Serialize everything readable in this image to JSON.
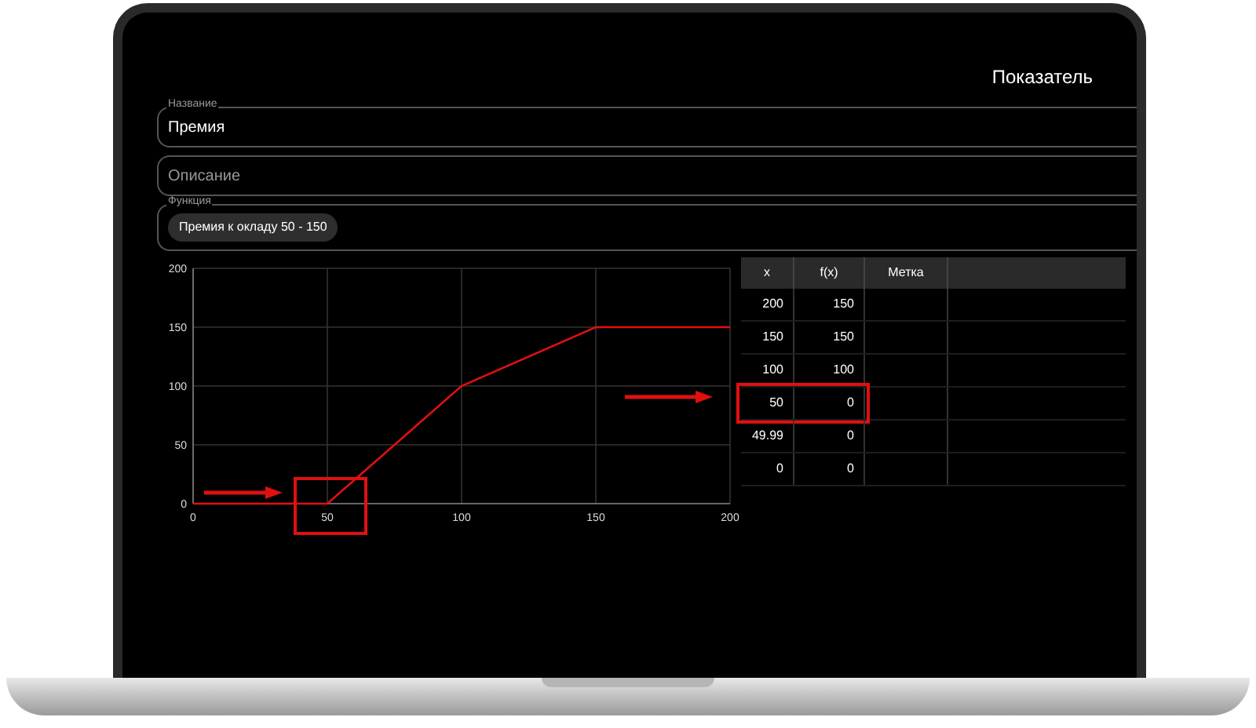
{
  "header": {
    "title": "Показатель"
  },
  "fields": [
    {
      "kind": "text",
      "label": "Название",
      "value": "Премия"
    },
    {
      "kind": "text",
      "placeholder": "Описание"
    },
    {
      "kind": "chips",
      "label": "Функция",
      "chips": [
        "Премия к окладу 50 - 150"
      ]
    }
  ],
  "chart": {
    "highlight_box": true,
    "chart_data": {
      "type": "line",
      "x": [
        0,
        49.99,
        50,
        100,
        150,
        200
      ],
      "series": [
        {
          "color": "#e01010",
          "values": [
            0,
            0,
            0,
            100,
            150,
            150
          ]
        }
      ],
      "xlim": [
        0,
        200
      ],
      "ylim": [
        0,
        200
      ],
      "xticks": [
        0,
        50,
        100,
        150,
        200
      ],
      "yticks": [
        0,
        50,
        100,
        150,
        200
      ],
      "grid": true
    }
  },
  "table": {
    "columns": [
      "x",
      "f(x)",
      "Метка"
    ],
    "rows": [
      {
        "cells": [
          "200",
          "150"
        ],
        "highlighted": false
      },
      {
        "cells": [
          "150",
          "150"
        ],
        "highlighted": false
      },
      {
        "cells": [
          "100",
          "100"
        ],
        "highlighted": false
      },
      {
        "cells": [
          "50",
          "0"
        ],
        "highlighted": true
      },
      {
        "cells": [
          "49.99",
          "0"
        ],
        "highlighted": false
      },
      {
        "cells": [
          "0",
          "0"
        ],
        "highlighted": false
      }
    ]
  }
}
